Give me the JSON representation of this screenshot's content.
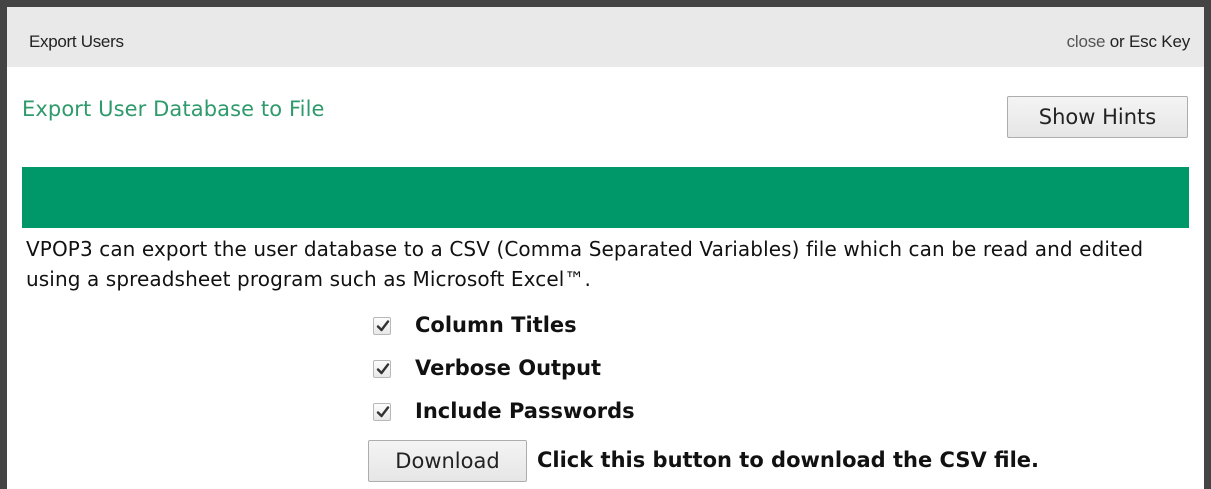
{
  "dialog": {
    "title": "Export Users",
    "close_link": "close",
    "close_suffix": " or Esc Key"
  },
  "main": {
    "heading": "Export User Database to File",
    "hints_button": "Show Hints",
    "description": "VPOP3 can export the user database to a CSV (Comma Separated Variables) file which can be read and edited using a spreadsheet program such as Microsoft Excel™.",
    "options": [
      {
        "label": "Column Titles",
        "checked": true
      },
      {
        "label": "Verbose Output",
        "checked": true
      },
      {
        "label": "Include Passwords",
        "checked": true
      }
    ],
    "download_button": "Download",
    "download_text": "Click this button to download the CSV file."
  },
  "colors": {
    "accent_green": "#009868",
    "heading_green": "#2f9a6c",
    "titlebar_bg": "#e9e9e9",
    "frame_border": "#444444"
  },
  "icons": {
    "checkbox": "check-icon"
  }
}
